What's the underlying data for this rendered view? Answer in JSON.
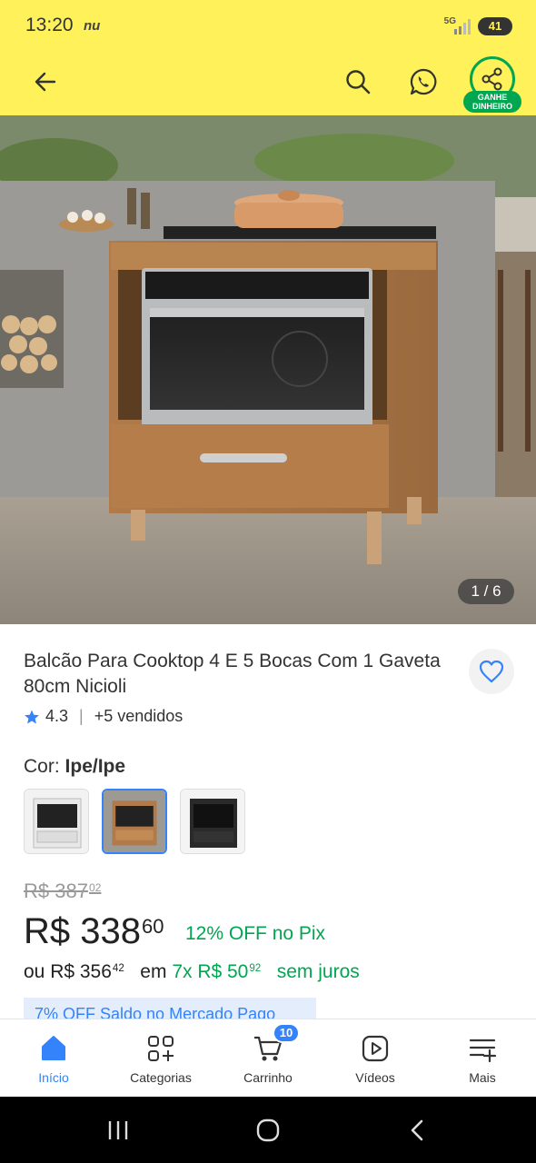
{
  "status": {
    "time": "13:20",
    "carrier": "nu",
    "network": "5G",
    "battery": "41"
  },
  "topbar": {
    "ganhe_line1": "GANHE",
    "ganhe_line2": "DINHEIRO"
  },
  "gallery": {
    "pager": "1 / 6"
  },
  "product": {
    "title": "Balcão Para Cooktop 4 E 5 Bocas Com 1 Gaveta 80cm Nicioli",
    "rating": "4.3",
    "sold": "+5 vendidos",
    "color_prefix": "Cor:",
    "color_value": "Ipe/Ipe",
    "variants": [
      "Branco",
      "Ipe/Ipe",
      "Preto"
    ],
    "selected_variant_index": 1
  },
  "pricing": {
    "old_main": "R$ 387",
    "old_cents": "02",
    "price_main": "R$ 338",
    "price_cents": "60",
    "discount": "12% OFF no Pix",
    "installment_prefix": "ou R$ 356",
    "installment_prefix_cents": "42",
    "installment_em": "em",
    "installment_count": "7x R$ 50",
    "installment_cents": "92",
    "installment_suffix": "sem juros",
    "promo": "7% OFF Saldo no Mercado Pago"
  },
  "nav": {
    "items": [
      {
        "label": "Início",
        "icon": "home-icon"
      },
      {
        "label": "Categorias",
        "icon": "grid-icon"
      },
      {
        "label": "Carrinho",
        "icon": "cart-icon"
      },
      {
        "label": "Vídeos",
        "icon": "play-icon"
      },
      {
        "label": "Mais",
        "icon": "menu-plus-icon"
      }
    ],
    "cart_count": "10",
    "active_index": 0
  },
  "colors": {
    "header": "#FFF159",
    "accent": "#3483FA",
    "green": "#00A650"
  }
}
